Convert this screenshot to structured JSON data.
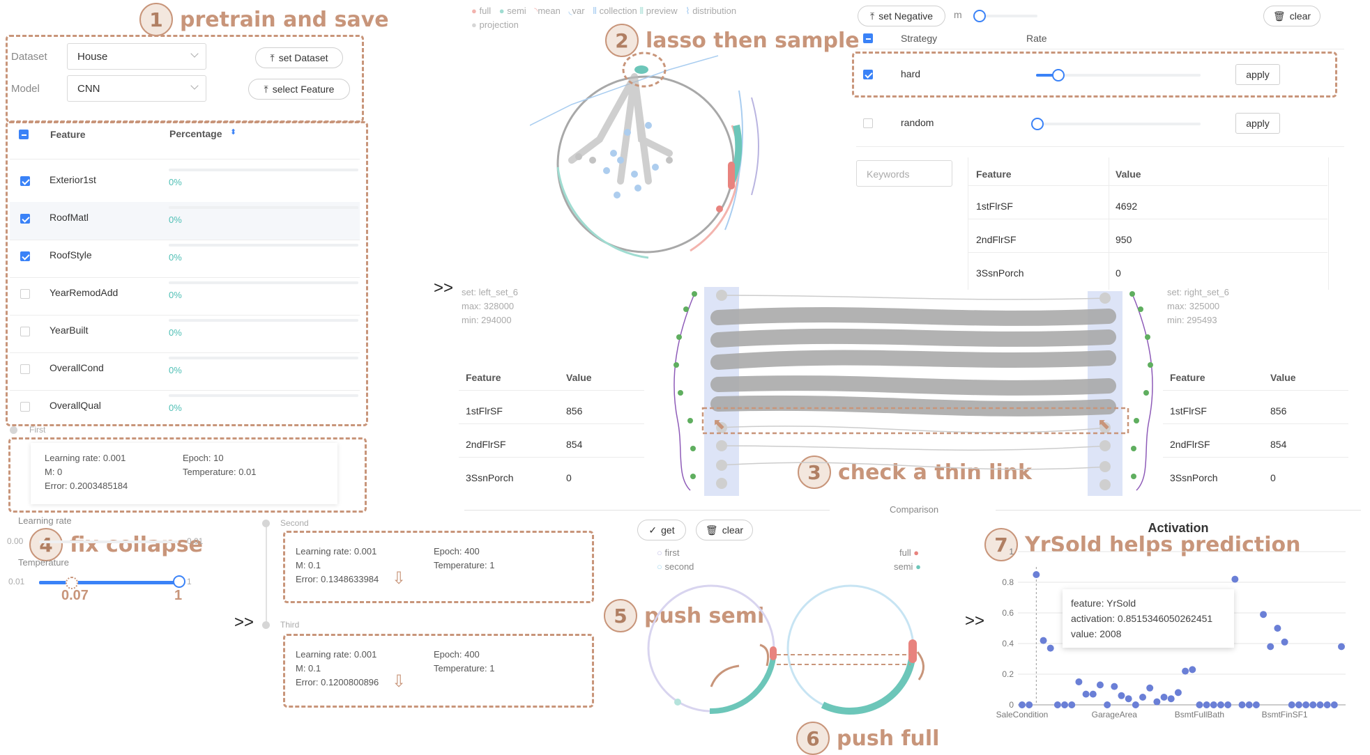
{
  "annotations": {
    "a1": {
      "num": "1",
      "text": "pretrain and save"
    },
    "a2": {
      "num": "2",
      "text": "lasso then sample"
    },
    "a3": {
      "num": "3",
      "text": "check a thin link"
    },
    "a4": {
      "num": "4",
      "text": "fix collapse"
    },
    "a5": {
      "num": "5",
      "text": "push semi"
    },
    "a6": {
      "num": "6",
      "text": "push full"
    },
    "a7": {
      "num": "7",
      "text": "YrSold helps prediction"
    }
  },
  "config": {
    "dataset_label": "Dataset",
    "dataset_value": "House",
    "model_label": "Model",
    "model_value": "CNN",
    "set_dataset": "set Dataset",
    "select_feature": "select Feature"
  },
  "feature_table": {
    "col_feature": "Feature",
    "col_percentage": "Percentage",
    "rows": [
      {
        "name": "Exterior1st",
        "pct": "0%",
        "checked": true
      },
      {
        "name": "RoofMatl",
        "pct": "0%",
        "checked": true
      },
      {
        "name": "RoofStyle",
        "pct": "0%",
        "checked": true
      },
      {
        "name": "YearRemodAdd",
        "pct": "0%",
        "checked": false
      },
      {
        "name": "YearBuilt",
        "pct": "0%",
        "checked": false
      },
      {
        "name": "OverallCond",
        "pct": "0%",
        "checked": false
      },
      {
        "name": "OverallQual",
        "pct": "0%",
        "checked": false
      }
    ]
  },
  "history": {
    "first": {
      "title": "First",
      "lr": "Learning rate: 0.001",
      "m": "M: 0",
      "err": "Error: 0.2003485184",
      "epoch": "Epoch: 10",
      "temp": "Temperature: 0.01"
    },
    "second": {
      "title": "Second",
      "lr": "Learning rate: 0.001",
      "m": "M: 0.1",
      "err": "Error: 0.1348633984",
      "epoch": "Epoch: 400",
      "temp": "Temperature: 1"
    },
    "third": {
      "title": "Third",
      "lr": "Learning rate: 0.001",
      "m": "M: 0.1",
      "err": "Error: 0.1200800896",
      "epoch": "Epoch: 400",
      "temp": "Temperature: 1"
    }
  },
  "params": {
    "lr_label": "Learning rate",
    "lr_min": "0.00",
    "lr_max": "0.01",
    "temp_label": "Temperature",
    "temp_min": "0.01",
    "temp_max": "1",
    "temp_from": "0.07",
    "temp_to": "1"
  },
  "scatter_legend": {
    "full": "full",
    "semi": "semi",
    "mean": "mean",
    "var": "var",
    "collection": "collection",
    "preview": "preview",
    "distribution": "distribution",
    "projection": "projection"
  },
  "sampling": {
    "set_negative": "set Negative",
    "m_label": "m",
    "clear": "clear",
    "col_strategy": "Strategy",
    "col_rate": "Rate",
    "rows": [
      {
        "name": "hard",
        "apply": "apply",
        "checked": true
      },
      {
        "name": "random",
        "apply": "apply",
        "checked": false
      }
    ],
    "keywords_placeholder": "Keywords",
    "detail": {
      "col_feature": "Feature",
      "col_value": "Value",
      "rows": [
        {
          "f": "1stFlrSF",
          "v": "4692"
        },
        {
          "f": "2ndFlrSF",
          "v": "950"
        },
        {
          "f": "3SsnPorch",
          "v": "0"
        }
      ]
    }
  },
  "comparison": {
    "left": {
      "set": "set: left_set_6",
      "max": "max: 328000",
      "min": "min: 294000",
      "col_feature": "Feature",
      "col_value": "Value",
      "rows": [
        {
          "f": "1stFlrSF",
          "v": "856"
        },
        {
          "f": "2ndFlrSF",
          "v": "854"
        },
        {
          "f": "3SsnPorch",
          "v": "0"
        }
      ]
    },
    "right": {
      "set": "set: right_set_6",
      "max": "max: 325000",
      "min": "min: 295493",
      "col_feature": "Feature",
      "col_value": "Value",
      "rows": [
        {
          "f": "1stFlrSF",
          "v": "856"
        },
        {
          "f": "2ndFlrSF",
          "v": "854"
        },
        {
          "f": "3SsnPorch",
          "v": "0"
        }
      ]
    },
    "title": "Comparison",
    "get": "get",
    "clear": "clear",
    "legend_first": "first",
    "legend_second": "second",
    "legend_full": "full",
    "legend_semi": "semi"
  },
  "activation": {
    "title": "Activation",
    "tooltip": {
      "feature": "feature: YrSold",
      "activation": "activation: 0.8515346050262451",
      "value": "value: 2008"
    }
  },
  "arrows": ">>",
  "colors": {
    "accent": "#c8957a",
    "teal": "#6cc6b9",
    "red": "#e8837e",
    "blue": "#3a82f7",
    "point": "#6a7fd6"
  },
  "chart_data": {
    "type": "scatter",
    "title": "Activation",
    "xlabel": "",
    "ylabel": "",
    "ylim": [
      0,
      1
    ],
    "yticks": [
      "0",
      "0.2",
      "0.4",
      "0.6",
      "0.8",
      "1"
    ],
    "xticks": [
      "SaleCondition",
      "GarageArea",
      "BsmtFullBath",
      "BsmtFinSF1"
    ],
    "x": [
      0,
      1,
      2,
      3,
      4,
      5,
      6,
      7,
      8,
      9,
      10,
      11,
      12,
      13,
      14,
      15,
      16,
      17,
      18,
      19,
      20,
      21,
      22,
      23,
      24,
      25,
      26,
      27,
      28,
      29,
      30,
      31,
      32,
      33,
      34,
      35,
      36,
      37,
      38,
      39,
      40,
      41,
      42,
      43,
      44,
      45
    ],
    "y": [
      0,
      0,
      0.85,
      0.42,
      0.37,
      0,
      0,
      0,
      0.15,
      0.07,
      0.07,
      0.13,
      0,
      0.12,
      0.06,
      0.04,
      0,
      0.05,
      0.11,
      0.02,
      0.05,
      0.04,
      0.08,
      0.22,
      0.23,
      0,
      0,
      0,
      0,
      0,
      0.82,
      0,
      0,
      0,
      0.59,
      0.38,
      0.5,
      0.41,
      0,
      0,
      0,
      0,
      0,
      0,
      0,
      0.38
    ]
  }
}
